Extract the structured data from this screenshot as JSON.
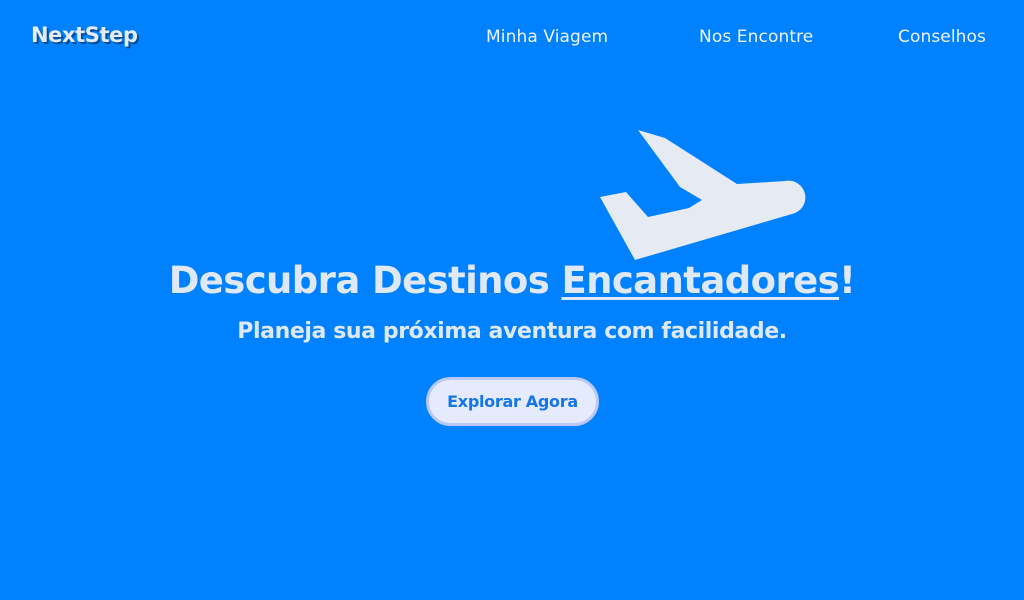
{
  "brand": {
    "name": "NextStep"
  },
  "nav": {
    "items": [
      {
        "label": "Minha Viagem"
      },
      {
        "label": "Nos Encontre"
      },
      {
        "label": "Conselhos"
      }
    ]
  },
  "hero": {
    "title_prefix": "Descubra Destinos ",
    "title_highlight": "Encantadores",
    "title_suffix": "!",
    "subtitle": "Planeja sua próxima aventura com facilidade.",
    "cta_label": "Explorar Agora",
    "icon": "airplane-takeoff-icon"
  },
  "colors": {
    "background": "#0081ff",
    "text": "#e4ebf7",
    "button_bg": "#e5eafc",
    "button_text": "#1576e6"
  }
}
